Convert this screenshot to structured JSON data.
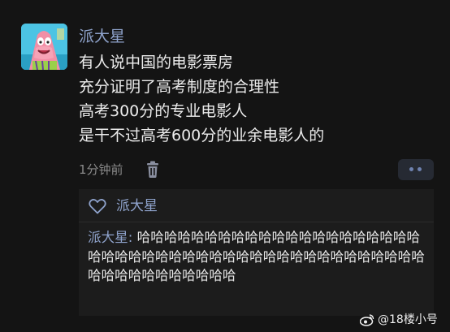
{
  "post": {
    "username": "派大星",
    "lines": [
      "有人说中国的电影票房",
      "充分证明了高考制度的合理性",
      "高考300分的专业电影人",
      "是干不过高考600分的业余电影人的"
    ],
    "timestamp": "1分钟前"
  },
  "likes": {
    "name": "派大星"
  },
  "reply": {
    "author": "派大星:",
    "text": "哈哈哈哈哈哈哈哈哈哈哈哈哈哈哈哈哈哈哈哈哈哈哈哈哈哈哈哈哈哈哈哈哈哈哈哈哈哈哈哈哈哈哈哈哈哈哈哈哈哈哈哈哈哈哈哈哈"
  },
  "watermark": {
    "text": "@18楼小号"
  },
  "icons": {
    "avatar": "patrick-star-avatar",
    "delete": "trash-icon",
    "more": "more-dots-icon",
    "like": "heart-icon",
    "watermark_logo": "weibo-icon"
  },
  "colors": {
    "background": "#141414",
    "name_blue": "#8fa3cc",
    "reply_bg": "#1c1c1c"
  }
}
